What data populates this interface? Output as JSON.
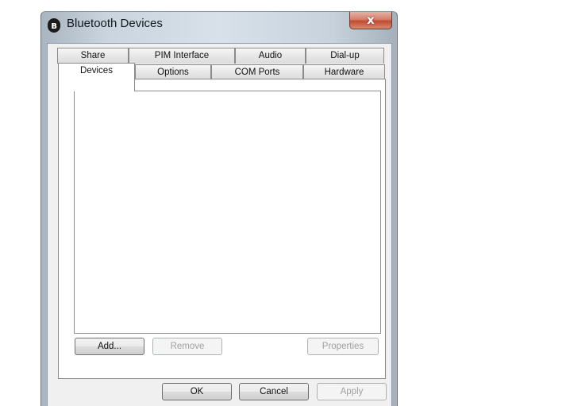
{
  "window": {
    "title": "Bluetooth Devices",
    "title_icon_glyph": "ʙ",
    "title_icon_name": "bluetooth-icon",
    "close_glyph": "x",
    "close_icon_name": "close-icon"
  },
  "tabs": {
    "back_row": [
      "Share",
      "PIM Interface",
      "Audio",
      "Dial-up"
    ],
    "front_row": [
      "Devices",
      "Options",
      "COM Ports",
      "Hardware"
    ],
    "selected": "Devices"
  },
  "devices_panel": {
    "device_list_items": [],
    "add_label": "Add...",
    "remove_label": "Remove",
    "properties_label": "Properties",
    "remove_enabled": false,
    "properties_enabled": false
  },
  "footer": {
    "ok_label": "OK",
    "cancel_label": "Cancel",
    "apply_label": "Apply",
    "apply_enabled": false
  },
  "colors": {
    "title_bar": "#c9d4de",
    "dialog_face": "#f0f0f0",
    "close_button": "#c24a30",
    "disabled_text": "#a0a0a0"
  }
}
